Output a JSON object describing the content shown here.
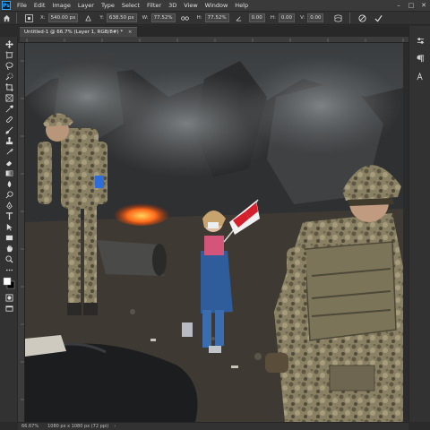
{
  "app": {
    "logo_text": "Ps"
  },
  "menu": [
    "File",
    "Edit",
    "Image",
    "Layer",
    "Type",
    "Select",
    "Filter",
    "3D",
    "View",
    "Window",
    "Help"
  ],
  "window_controls": {
    "minimize": "–",
    "maximize": "□",
    "close": "✕"
  },
  "options": {
    "x_label": "X:",
    "x_value": "540.00 px",
    "y_label": "Y:",
    "y_value": "638.50 px",
    "w_label": "W:",
    "w_value": "77.52%",
    "h_label": "H:",
    "h_value": "77.52%",
    "angle_value": "0.00",
    "hskew_label": "H:",
    "hskew_value": "0.00",
    "vskew_label": "V:",
    "vskew_value": "0.00"
  },
  "document": {
    "tab_title": "Untitled-1 @ 66.7% (Layer 1, RGB/8#) *",
    "close_symbol": "×"
  },
  "status": {
    "zoom": "66.67%",
    "doc_info": "1080 px x 1080 px (72 ppi)",
    "arrow": "›"
  },
  "colors": {
    "ui_bg": "#323232",
    "menubar_bg": "#3a3a3a",
    "accent_blue": "#31a8ff",
    "fire": "#ff6a1a",
    "flag_red": "#d51f2d",
    "armband_blue": "#2f6dd8"
  }
}
